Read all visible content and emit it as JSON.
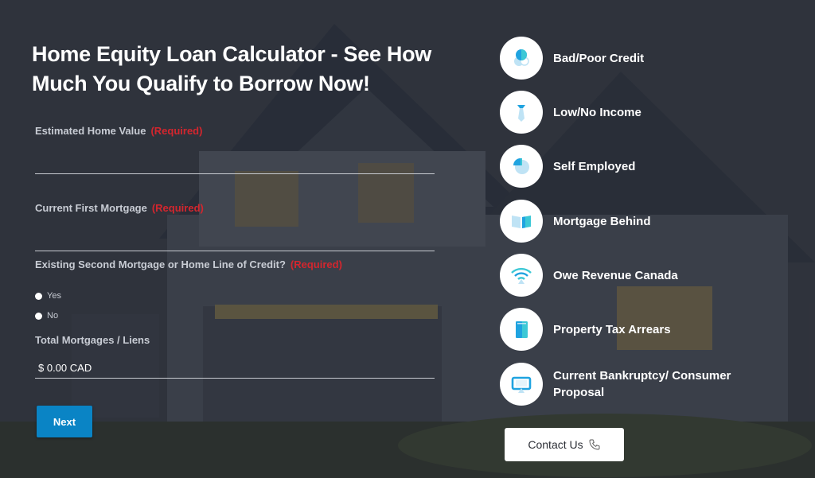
{
  "header": {
    "title": "Home Equity Loan Calculator - See How Much You Qualify to Borrow Now!"
  },
  "form": {
    "required_label": "(Required)",
    "estimated_home_value": {
      "label": "Estimated Home Value",
      "value": "",
      "placeholder": ""
    },
    "current_first_mortgage": {
      "label": "Current First Mortgage",
      "value": "",
      "placeholder": ""
    },
    "second_mortgage": {
      "label": "Existing Second Mortgage or Home Line of Credit?",
      "options": [
        "Yes",
        "No"
      ]
    },
    "total_mortgages": {
      "label": "Total Mortgages / Liens",
      "value": "$ 0.00 CAD"
    },
    "next_label": "Next"
  },
  "features": [
    {
      "label": "Bad/Poor Credit",
      "icon": "credit-circles-icon"
    },
    {
      "label": "Low/No Income",
      "icon": "tie-icon"
    },
    {
      "label": "Self Employed",
      "icon": "pie-chart-icon"
    },
    {
      "label": "Mortgage Behind",
      "icon": "open-book-icon"
    },
    {
      "label": "Owe Revenue Canada",
      "icon": "wifi-signal-icon"
    },
    {
      "label": "Property Tax Arrears",
      "icon": "tablet-icon"
    },
    {
      "label": "Current Bankruptcy/ Consumer Proposal",
      "icon": "monitor-icon"
    }
  ],
  "contact": {
    "label": "Contact Us",
    "icon": "phone-icon"
  },
  "colors": {
    "accent": "#0a84c5",
    "required": "#d3262e",
    "icon_blue": "#1fa3e0",
    "icon_teal": "#3cc8d6"
  }
}
